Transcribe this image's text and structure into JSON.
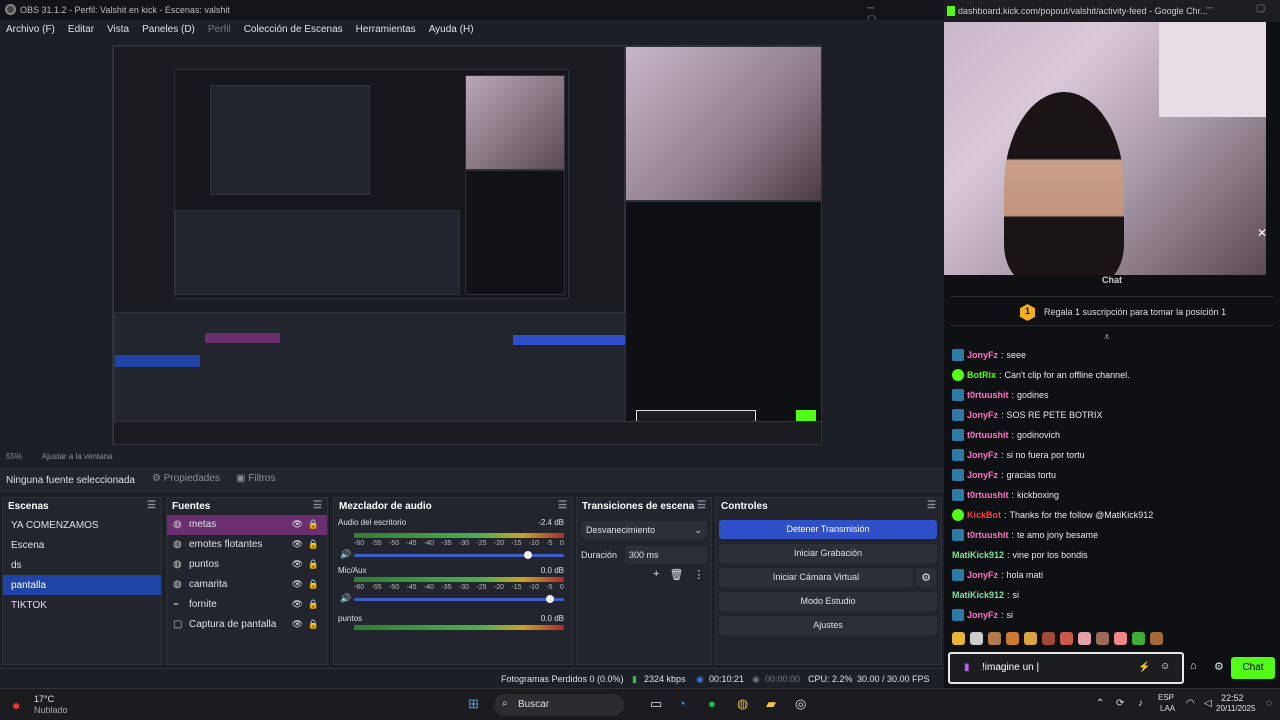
{
  "obs": {
    "title": "OBS 31.1.2 - Perfil: Valshit en kick - Escenas: valshit",
    "menu": [
      "Archivo (F)",
      "Editar",
      "Vista",
      "Paneles (D)",
      "Perfil",
      "Colección de Escenas",
      "Herramientas",
      "Ayuda (H)"
    ],
    "zoom": "55%",
    "zoom_mode": "Ajustar a la ventana",
    "no_source": "Ninguna fuente seleccionada",
    "properties_label": "Propiedades",
    "filters_label": "Filtros",
    "scenes_title": "Escenas",
    "scenes": [
      "YA COMENZAMOS",
      "Escena",
      "ds",
      "pantalla",
      "TIKTOK"
    ],
    "sources_title": "Fuentes",
    "sources": [
      "metas",
      "emotes flotantes",
      "puntos",
      "camarita",
      "fornite",
      "Captura de pantalla"
    ],
    "mixer_title": "Mezclador de audio",
    "mixer": [
      {
        "name": "Audio del escritorio",
        "db": "-2.4 dB",
        "level": 0.88
      },
      {
        "name": "Mic/Aux",
        "db": "0.0 dB",
        "level": 0.78
      },
      {
        "name": "puntos",
        "db": "0.0 dB",
        "level": 0.0
      }
    ],
    "scale": [
      "-60",
      "-55",
      "-50",
      "-45",
      "-40",
      "-35",
      "-30",
      "-25",
      "-20",
      "-15",
      "-10",
      "-5",
      "0"
    ],
    "transitions_title": "Transiciones de escena",
    "transition": "Desvanecimiento",
    "duration_label": "Duración",
    "duration_value": "300 ms",
    "controls_title": "Controles",
    "controls": [
      "Detener Transmisión",
      "Iniciar Grabación",
      "Iniciar Cámara Virtual",
      "Modo Estudio",
      "Ajustes"
    ],
    "status": {
      "dropped": "Fotogramas Perdidos 0 (0.0%)",
      "bitrate": "2324 kbps",
      "stream_time": "00:10:21",
      "rec_time": "00:00:00",
      "cpu": "CPU: 2.2%",
      "fps": "30.00 / 30.00 FPS"
    }
  },
  "kick": {
    "title": "dashboard.kick.com/popout/valshit/activity-feed - Google Chr...",
    "chat_header": "Chat",
    "gift_text": "Regala 1 suscripción para tomar la posición 1",
    "gift_num": "1",
    "messages": [
      {
        "user": "JonyFz",
        "text": "seee",
        "color": "#ff6ec7",
        "badge": "b"
      },
      {
        "user": "BotRix",
        "text": "Can't clip for an offline channel.",
        "color": "#53fc18",
        "badge": "g"
      },
      {
        "user": "t0rtuushit",
        "text": "godines",
        "color": "#ff6ec7",
        "badge": "b"
      },
      {
        "user": "JonyFz",
        "text": "SOS RE PETE BOTRIX",
        "color": "#ff6ec7",
        "badge": "b"
      },
      {
        "user": "t0rtuushit",
        "text": "godinovich",
        "color": "#ff6ec7",
        "badge": "b"
      },
      {
        "user": "JonyFz",
        "text": "si no fuera por tortu",
        "color": "#ff6ec7",
        "badge": "b"
      },
      {
        "user": "JonyFz",
        "text": "gracias tortu",
        "color": "#ff6ec7",
        "badge": "b"
      },
      {
        "user": "t0rtuushit",
        "text": "kickboxing",
        "color": "#ff6ec7",
        "badge": "b"
      },
      {
        "user": "KickBot",
        "text": "Thanks for the follow @MatiKick912",
        "color": "#ff3b3b",
        "badge": "g"
      },
      {
        "user": "t0rtuushit",
        "text": "te amo jony besame",
        "color": "#ff6ec7",
        "badge": "b"
      },
      {
        "user": "MatiKick912",
        "text": "vine por los bondis",
        "color": "#7ee0a0",
        "badge": ""
      },
      {
        "user": "JonyFz",
        "text": "hola mati",
        "color": "#ff6ec7",
        "badge": "b"
      },
      {
        "user": "MatiKick912",
        "text": "si",
        "color": "#7ee0a0",
        "badge": ""
      },
      {
        "user": "JonyFz",
        "text": "si",
        "color": "#ff6ec7",
        "badge": "b"
      }
    ],
    "input_value": "!imagine un |",
    "chat_button": "Chat"
  },
  "taskbar": {
    "weather_temp": "17°C",
    "weather_desc": "Nublado",
    "search": "Buscar",
    "lang": "ESP",
    "lang2": "LAA",
    "time": "22:52",
    "date": "20/11/2025"
  },
  "colors": {
    "accent_blue": "#2f50c8",
    "kick_green": "#53fc18",
    "selected_source": "#6b2e6e"
  }
}
